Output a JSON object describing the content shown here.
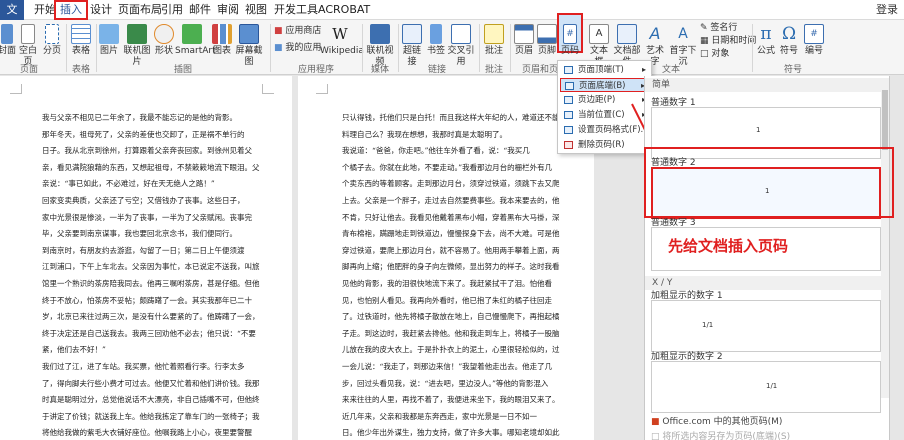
{
  "menu": {
    "tabs": [
      "文件",
      "开始",
      "插入",
      "设计",
      "页面布局",
      "引用",
      "邮件",
      "审阅",
      "视图",
      "开发工具",
      "ACROBAT"
    ],
    "login": "登录"
  },
  "ribbon": {
    "buttons": [
      "封面",
      "空白页",
      "分页",
      "表格",
      "图片",
      "联机图片",
      "形状",
      "SmartArt",
      "图表",
      "屏幕截图",
      "应用商店",
      "我的应用",
      "Wikipedia",
      "联机视频",
      "超链接",
      "书签",
      "交叉引用",
      "批注",
      "页眉",
      "页脚",
      "页码",
      "文本框",
      "文档部件",
      "艺术字",
      "首字下沉",
      "签名行",
      "日期和时间",
      "对象",
      "公式",
      "符号",
      "编号"
    ],
    "groups": [
      "页面",
      "表格",
      "插图",
      "应用程序",
      "媒体",
      "链接",
      "批注",
      "页眉和页脚",
      "文本",
      "符号"
    ]
  },
  "dropdown": {
    "items": [
      "页面顶端(T)",
      "页面底端(B)",
      "页边距(P)",
      "当前位置(C)",
      "设置页码格式(F)...",
      "删除页码(R)"
    ]
  },
  "gallery": {
    "section_simple": "简单",
    "section_xy": "X / Y",
    "items": [
      "普通数字 1",
      "普通数字 2",
      "普通数字 3",
      "加粗显示的数字 1",
      "加粗显示的数字 2"
    ],
    "num1": "1",
    "num2": "1",
    "numxy1": "1/1",
    "numxy2": "1/1",
    "footer1": "Office.com 中的其他页码(M)",
    "footer2": "将所选内容另存为页码(底端)(S)"
  },
  "callout": "先给文档插入页码",
  "doc": {
    "page1": "我与父亲不相见已二年余了，我最不能忘记的是他的背影。\n那年冬天，祖母死了，父亲的差使也交卸了，正是祸不单行的\n日子。我从北京到徐州，打算跟着父亲奔丧回家。到徐州见着父\n亲，看见满院狼藉的东西，又想起祖母，不禁簌簌地流下眼泪。父\n亲说：“事已如此，不必难过，好在天无绝人之路！”\n回家变卖典质，父亲还了亏空；又借钱办了丧事。这些日子，\n家中光景很是惨淡，一半为了丧事，一半为了父亲赋闲。丧事完\n毕，父亲要到南京谋事，我也要回北京念书，我们便同行。\n到南京时，有朋友约去游逛，勾留了一日；第二日上午便须渡\n江到浦口，下午上车北去。父亲因为事忙，本已说定不送我，叫旅\n馆里一个熟识的茶房陪我同去。他再三嘱咐茶房，甚是仔细。但他\n终于不放心，怕茶房不妥帖；颇踌躇了一会。其实我那年已二十\n岁，北京已来往过两三次，是没有什么要紧的了。他踌躇了一会，\n终于决定还是自己送我去。我两三回劝他不必去；他只说：“不要\n紧，他们去不好！”\n我们过了江，进了车站。我买票，他忙着照看行李。行李太多\n了，得向脚夫行些小费才可过去。他便又忙着和他们讲价钱。我那\n时真是聪明过分，总觉他说话不大漂亮，非自己插嘴不可，但他终\n于讲定了价钱；就送我上车。他给我拣定了靠车门的一张椅子；我\n将他给我做的紫毛大衣铺好座位。他嘱我路上小心，夜里要警醒\n些，不要受凉。又嘱托茶房好好照应我。我心里暗笑他的迂；他们",
    "page2": "只认得钱，托他们只是白托！而且我这样大年纪的人，难道还不能\n料理自己么？我现在想想，我那时真是太聪明了。\n我说道：“爸爸，你走吧。”他往车外看了看，说：“我买几\n个橘子去。你就在此地，不要走动。”我看那边月台的栅栏外有几\n个卖东西的等着顾客。走到那边月台，须穿过铁道，须跳下去又爬\n上去。父亲是一个胖子，走过去自然要费事些。我本来要去的，他\n不肯，只好让他去。我看见他戴着黑布小帽，穿着黑布大马褂，深\n青布棉袍，蹒跚地走到铁道边，慢慢探身下去，尚不大难。可是他\n穿过铁道，要爬上那边月台，就不容易了。他用两手攀着上面，两\n脚再向上缩；他肥胖的身子向左微倾，显出努力的样子。这时我看\n见他的背影，我的泪很快地流下来了。我赶紧拭干了泪。怕他看\n见，也怕别人看见。我再向外看时，他已抱了朱红的橘子往回走\n了。过铁道时，他先将橘子散放在地上，自己慢慢爬下，再抱起橘\n子走。到这边时，我赶紧去搀他。他和我走到车上，将橘子一股脑\n儿放在我的皮大衣上。于是扑扑衣上的泥土，心里很轻松似的，过\n一会儿说：“我走了，到那边来信！”我望着他走出去。他走了几\n步，回过头看见我，说：“进去吧，里边没人。”等他的背影混入\n来来往往的人里，再找不着了，我便进来坐下，我的眼泪又来了。\n近几年来，父亲和我都是东奔西走，家中光景是一日不如一\n日。他少年出外谋生，独力支持，做了许多大事。哪知老境却如此\n颓唐！他触目伤怀，自然情不能自已。情郁于中，自然要发之于"
  }
}
